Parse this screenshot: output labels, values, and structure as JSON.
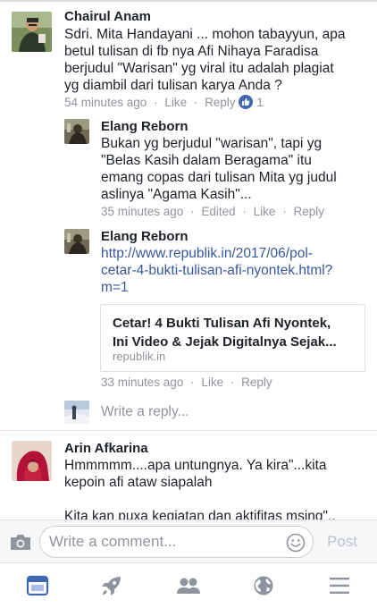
{
  "comments": [
    {
      "name": "Chairul Anam",
      "lines": [
        "Sdri. Mita Handayani ... mohon tabayyun, apa",
        "betul tulisan di fb nya Afi Nihaya Faradisa",
        "berjudul \"Warisan\" yg viral itu adalah plagiat",
        "yg diambil dari tulisan karya Anda ?"
      ],
      "time": "54 minutes ago",
      "like": "Like",
      "reply": "Reply",
      "like_count": "1"
    },
    {
      "name": "Elang Reborn",
      "lines": [
        "Bukan yg berjudul \"warisan\", tapi yg",
        "\"Belas Kasih dalam Beragama\" itu",
        "emang copas dari tulisan Mita yg judul",
        "aslinya \"Agama Kasih\"..."
      ],
      "time": "35 minutes ago",
      "edited": "Edited",
      "like": "Like",
      "reply": "Reply"
    },
    {
      "name": "Elang Reborn",
      "link_lines": [
        "http://www.republik.in/2017/06/pol-",
        "cetar-4-bukti-tulisan-afi-nyontek.html?",
        "m=1"
      ],
      "card": {
        "title_line1": "Cetar! 4 Bukti Tulisan Afi Nyontek,",
        "title_line2": "Ini Video & Jejak Digitalnya Sejak...",
        "domain": "republik.in"
      },
      "time": "33 minutes ago",
      "like": "Like",
      "reply": "Reply"
    },
    {
      "name": "Arin Afkarina",
      "lines": [
        "Hmmmmm....apa untungnya. Ya kira\"...kita",
        "kepoin afi ataw siapalah",
        "",
        "Kita kan puxa kegiatan dan aktifitas msing\".."
      ]
    }
  ],
  "reply_placeholder": "Write a reply...",
  "composer": {
    "placeholder": "Write a comment...",
    "post_label": "Post"
  },
  "separator": "·",
  "colors": {
    "link": "#365899",
    "meta": "#90949c",
    "tab_active": "#4267b2",
    "tab_inactive": "#8d949e"
  },
  "icons": [
    "camera-icon",
    "smiley-icon",
    "news-feed-icon",
    "rocket-icon",
    "friends-icon",
    "globe-icon",
    "menu-icon",
    "like-thumb-icon"
  ]
}
